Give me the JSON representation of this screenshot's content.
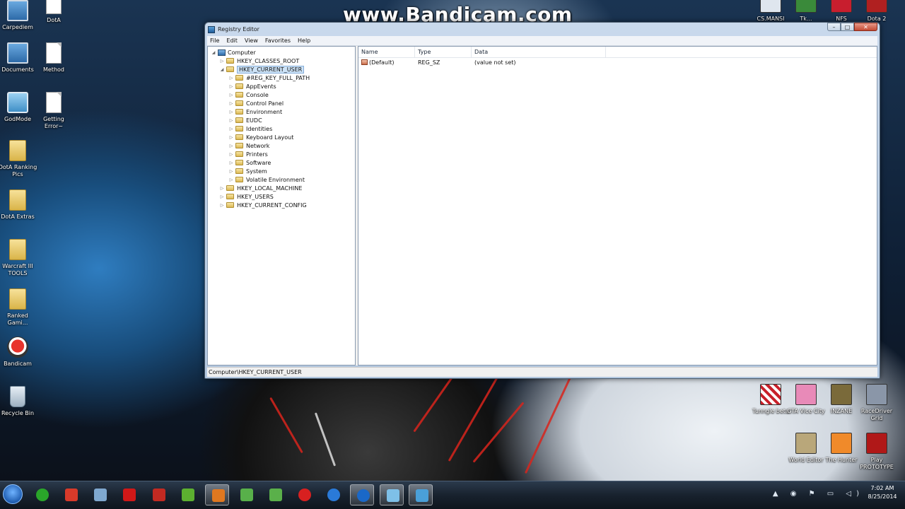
{
  "watermark": "www.Bandicam.com",
  "desktop": {
    "left_icons": [
      {
        "label": "Carpediem",
        "icon": "monitor-icon"
      },
      {
        "label": "Documents",
        "icon": "documents-icon"
      },
      {
        "label": "GodMode",
        "icon": "godmode-icon"
      },
      {
        "label": "DotA Ranking Pics",
        "icon": "folder-icon"
      },
      {
        "label": "DotA Extras",
        "icon": "folder-icon"
      },
      {
        "label": "Warcraft III TOOLS",
        "icon": "folder-icon"
      },
      {
        "label": "Ranked Gami...",
        "icon": "folder-icon"
      },
      {
        "label": "Bandicam",
        "icon": "bandicam-icon"
      },
      {
        "label": "Recycle Bin",
        "icon": "recycle-bin-icon"
      }
    ],
    "second_column_icons": [
      {
        "label": "DotA",
        "icon": "document-icon"
      },
      {
        "label": "Method",
        "icon": "document-icon"
      },
      {
        "label": "Getting Error~",
        "icon": "document-icon"
      }
    ],
    "top_right_icons": [
      {
        "label": "CS.MANSI",
        "icon": "cs-icon"
      },
      {
        "label": "Tk...",
        "icon": "tk-icon"
      },
      {
        "label": "NFS",
        "icon": "nfs-icon"
      },
      {
        "label": "Dota 2",
        "icon": "dota2-icon"
      }
    ],
    "bottom_right_icons": [
      {
        "label": "Tunngle beta",
        "icon": "tunngle-icon"
      },
      {
        "label": "GTA Vice City",
        "icon": "gta-icon"
      },
      {
        "label": "INZANE",
        "icon": "inzane-icon"
      },
      {
        "label": "RaceDriver Grid",
        "icon": "grid-icon"
      },
      {
        "label": "World Editor",
        "icon": "world-editor-icon"
      },
      {
        "label": "The Hunter",
        "icon": "hunter-icon"
      },
      {
        "label": "Play PROTOTYPE",
        "icon": "prototype-icon"
      }
    ]
  },
  "window": {
    "title": "Registry Editor",
    "menu": [
      "File",
      "Edit",
      "View",
      "Favorites",
      "Help"
    ],
    "tree": {
      "root": "Computer",
      "items": [
        {
          "label": "HKEY_CLASSES_ROOT",
          "level": 1,
          "expanded": false,
          "selected": false
        },
        {
          "label": "HKEY_CURRENT_USER",
          "level": 1,
          "expanded": true,
          "selected": true
        },
        {
          "label": "#REG_KEY_FULL_PATH",
          "level": 2,
          "expanded": false,
          "selected": false
        },
        {
          "label": "AppEvents",
          "level": 2,
          "expanded": false,
          "selected": false
        },
        {
          "label": "Console",
          "level": 2,
          "expanded": false,
          "selected": false
        },
        {
          "label": "Control Panel",
          "level": 2,
          "expanded": false,
          "selected": false
        },
        {
          "label": "Environment",
          "level": 2,
          "expanded": false,
          "selected": false
        },
        {
          "label": "EUDC",
          "level": 2,
          "expanded": false,
          "selected": false
        },
        {
          "label": "Identities",
          "level": 2,
          "expanded": false,
          "selected": false
        },
        {
          "label": "Keyboard Layout",
          "level": 2,
          "expanded": false,
          "selected": false
        },
        {
          "label": "Network",
          "level": 2,
          "expanded": false,
          "selected": false
        },
        {
          "label": "Printers",
          "level": 2,
          "expanded": false,
          "selected": false
        },
        {
          "label": "Software",
          "level": 2,
          "expanded": false,
          "selected": false
        },
        {
          "label": "System",
          "level": 2,
          "expanded": false,
          "selected": false
        },
        {
          "label": "Volatile Environment",
          "level": 2,
          "expanded": false,
          "selected": false
        },
        {
          "label": "HKEY_LOCAL_MACHINE",
          "level": 1,
          "expanded": false,
          "selected": false
        },
        {
          "label": "HKEY_USERS",
          "level": 1,
          "expanded": false,
          "selected": false
        },
        {
          "label": "HKEY_CURRENT_CONFIG",
          "level": 1,
          "expanded": false,
          "selected": false
        }
      ]
    },
    "columns": [
      "Name",
      "Type",
      "Data"
    ],
    "values": [
      {
        "name": "(Default)",
        "type": "REG_SZ",
        "data": "(value not set)"
      }
    ],
    "status": "Computer\\HKEY_CURRENT_USER"
  },
  "taskbar": {
    "clock_time": "7:02 AM",
    "clock_date": "8/25/2014",
    "pinned": [
      {
        "icon": "xbox-icon",
        "color": "#2aa52a"
      },
      {
        "icon": "paint-icon",
        "color": "#d83a2a"
      },
      {
        "icon": "calculator-icon",
        "color": "#7fa8cf"
      },
      {
        "icon": "puzzle-icon",
        "color": "#d01818"
      },
      {
        "icon": "bandicam-task-icon",
        "color": "#c22a22"
      },
      {
        "icon": "utorrent-icon",
        "color": "#5cb030"
      },
      {
        "icon": "settings-task-icon",
        "color": "#e07820"
      },
      {
        "icon": "calc2-icon",
        "color": "#58b04a"
      },
      {
        "icon": "windows-flag-icon",
        "color": "#5ab04a"
      },
      {
        "icon": "power-icon",
        "color": "#d82020"
      },
      {
        "icon": "browser-icon",
        "color": "#2a7ad8"
      },
      {
        "icon": "ie-icon",
        "color": "#1a68c8"
      },
      {
        "icon": "cube-icon",
        "color": "#7ec0e8"
      },
      {
        "icon": "regedit-task-icon",
        "color": "#4aa0d8"
      }
    ]
  },
  "colors": {
    "selection": "#cde3f7",
    "titlebar": "#c9d9ec"
  }
}
